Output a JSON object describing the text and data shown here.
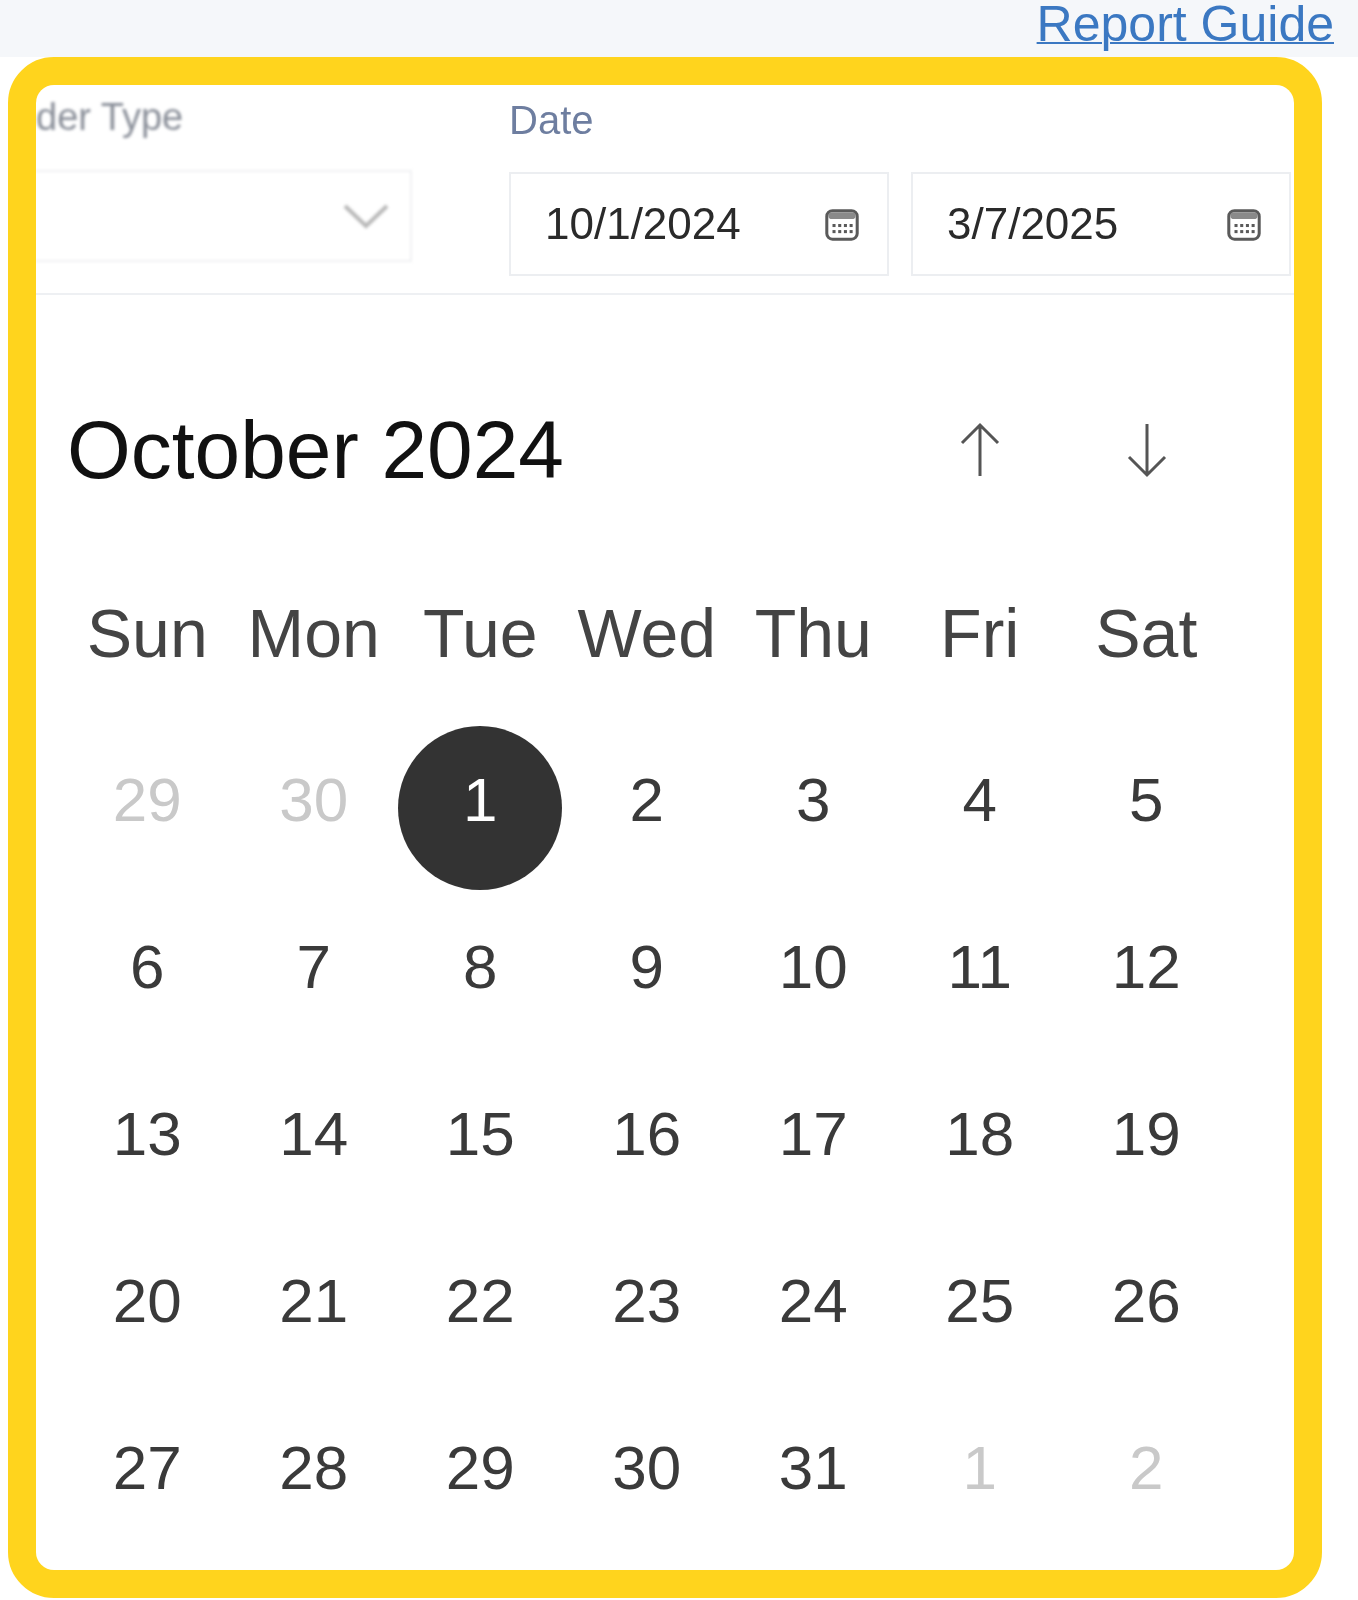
{
  "header": {
    "link": "Report Guide"
  },
  "filters": {
    "order_type": {
      "label": "der Type"
    },
    "date": {
      "label": "Date",
      "fields": [
        {
          "value": "10/1/2024"
        },
        {
          "value": "3/7/2025"
        }
      ]
    }
  },
  "calendar": {
    "title": "October 2024",
    "weekdays": [
      "Sun",
      "Mon",
      "Tue",
      "Wed",
      "Thu",
      "Fri",
      "Sat"
    ],
    "days": [
      {
        "label": "29",
        "outside_month": true,
        "selected": false
      },
      {
        "label": "30",
        "outside_month": true,
        "selected": false
      },
      {
        "label": "1",
        "outside_month": false,
        "selected": true
      },
      {
        "label": "2",
        "outside_month": false,
        "selected": false
      },
      {
        "label": "3",
        "outside_month": false,
        "selected": false
      },
      {
        "label": "4",
        "outside_month": false,
        "selected": false
      },
      {
        "label": "5",
        "outside_month": false,
        "selected": false
      },
      {
        "label": "6",
        "outside_month": false,
        "selected": false
      },
      {
        "label": "7",
        "outside_month": false,
        "selected": false
      },
      {
        "label": "8",
        "outside_month": false,
        "selected": false
      },
      {
        "label": "9",
        "outside_month": false,
        "selected": false
      },
      {
        "label": "10",
        "outside_month": false,
        "selected": false
      },
      {
        "label": "11",
        "outside_month": false,
        "selected": false
      },
      {
        "label": "12",
        "outside_month": false,
        "selected": false
      },
      {
        "label": "13",
        "outside_month": false,
        "selected": false
      },
      {
        "label": "14",
        "outside_month": false,
        "selected": false
      },
      {
        "label": "15",
        "outside_month": false,
        "selected": false
      },
      {
        "label": "16",
        "outside_month": false,
        "selected": false
      },
      {
        "label": "17",
        "outside_month": false,
        "selected": false
      },
      {
        "label": "18",
        "outside_month": false,
        "selected": false
      },
      {
        "label": "19",
        "outside_month": false,
        "selected": false
      },
      {
        "label": "20",
        "outside_month": false,
        "selected": false
      },
      {
        "label": "21",
        "outside_month": false,
        "selected": false
      },
      {
        "label": "22",
        "outside_month": false,
        "selected": false
      },
      {
        "label": "23",
        "outside_month": false,
        "selected": false
      },
      {
        "label": "24",
        "outside_month": false,
        "selected": false
      },
      {
        "label": "25",
        "outside_month": false,
        "selected": false
      },
      {
        "label": "26",
        "outside_month": false,
        "selected": false
      },
      {
        "label": "27",
        "outside_month": false,
        "selected": false
      },
      {
        "label": "28",
        "outside_month": false,
        "selected": false
      },
      {
        "label": "29",
        "outside_month": false,
        "selected": false
      },
      {
        "label": "30",
        "outside_month": false,
        "selected": false
      },
      {
        "label": "31",
        "outside_month": false,
        "selected": false
      },
      {
        "label": "1",
        "outside_month": true,
        "selected": false
      },
      {
        "label": "2",
        "outside_month": true,
        "selected": false
      }
    ]
  }
}
